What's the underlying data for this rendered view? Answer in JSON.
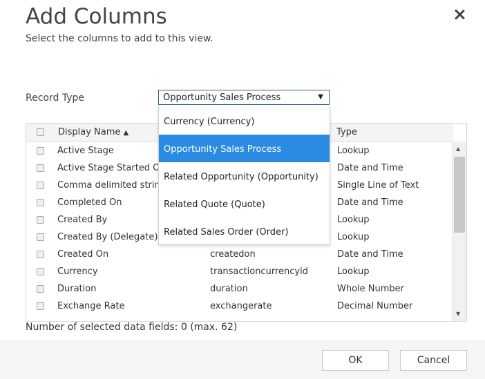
{
  "dialog": {
    "title": "Add Columns",
    "subtitle": "Select the columns to add to this view."
  },
  "record_type": {
    "label": "Record Type",
    "selected": "Opportunity Sales Process",
    "options": [
      "Currency (Currency)",
      "Opportunity Sales Process",
      "Related Opportunity (Opportunity)",
      "Related Quote (Quote)",
      "Related Sales Order (Order)"
    ]
  },
  "grid": {
    "headers": {
      "display_name": "Display Name",
      "type": "Type"
    },
    "sort_indicator": "▲",
    "rows": [
      {
        "display": "Active Stage",
        "schema": "",
        "type": "Lookup"
      },
      {
        "display": "Active Stage Started On",
        "schema": "",
        "type": "Date and Time"
      },
      {
        "display": "Comma delimited string",
        "schema": "",
        "type": "Single Line of Text"
      },
      {
        "display": "Completed On",
        "schema": "",
        "type": "Date and Time"
      },
      {
        "display": "Created By",
        "schema": "",
        "type": "Lookup"
      },
      {
        "display": "Created By (Delegate)",
        "schema": "",
        "type": "Lookup"
      },
      {
        "display": "Created On",
        "schema": "createdon",
        "type": "Date and Time"
      },
      {
        "display": "Currency",
        "schema": "transactioncurrencyid",
        "type": "Lookup"
      },
      {
        "display": "Duration",
        "schema": "duration",
        "type": "Whole Number"
      },
      {
        "display": "Exchange Rate",
        "schema": "exchangerate",
        "type": "Decimal Number"
      }
    ]
  },
  "status": {
    "selected_count": "Number of selected data fields: 0 (max. 62)"
  },
  "footer": {
    "ok_label": "OK",
    "cancel_label": "Cancel"
  },
  "colors": {
    "accent": "#2b8ae2",
    "select_border": "#2a5b8f"
  }
}
